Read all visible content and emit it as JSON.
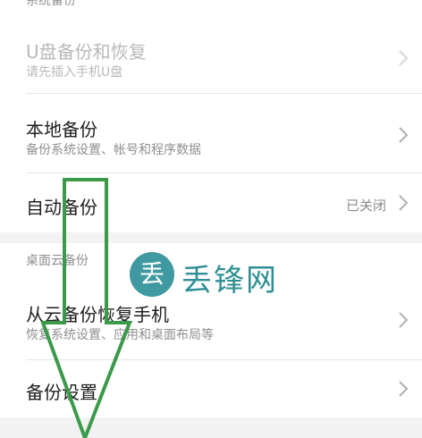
{
  "sections": {
    "system_backup": "系统备份",
    "cloud_backup": "桌面云备份"
  },
  "rows": {
    "usb": {
      "title": "U盘备份和恢复",
      "subtitle": "请先插入手机U盘",
      "enabled": false
    },
    "local": {
      "title": "本地备份",
      "subtitle": "备份系统设置、帐号和程序数据"
    },
    "auto": {
      "title": "自动备份",
      "value": "已关闭"
    },
    "restore_cloud": {
      "title": "从云备份恢复手机",
      "subtitle": "恢复系统设置、应用和桌面布局等"
    },
    "settings": {
      "title": "备份设置"
    }
  },
  "watermark": {
    "icon_char": "丢",
    "text": "丢锋网"
  },
  "colors": {
    "annotation_arrow": "#3a9a4a",
    "watermark": "#2f8f94"
  },
  "icons": {
    "row_chevron": "chevron-right-icon",
    "annotation": "down-arrow-annotation"
  }
}
